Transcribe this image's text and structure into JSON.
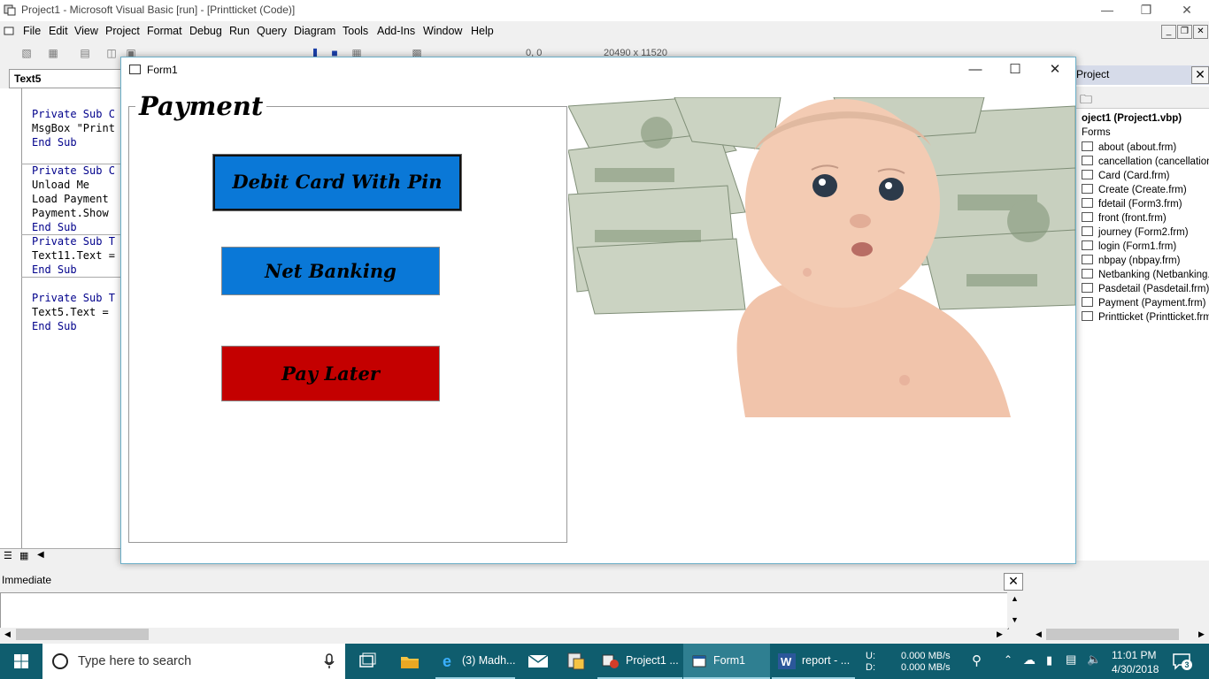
{
  "ide": {
    "title": "Project1 - Microsoft Visual Basic [run] - [Printticket (Code)]",
    "minimize_icon": "minimize-icon",
    "maximize_icon": "restore-icon",
    "close_icon": "close-icon"
  },
  "menu": [
    "File",
    "Edit",
    "View",
    "Project",
    "Format",
    "Debug",
    "Run",
    "Query",
    "Diagram",
    "Tools",
    "Add-Ins",
    "Window",
    "Help"
  ],
  "toolbar": {
    "position": "0, 0",
    "size": "20490 x 11520"
  },
  "code_window": {
    "object_combo": "Text5",
    "lines": [
      {
        "text": "Private Sub C",
        "kw": true
      },
      {
        "text": "MsgBox \"Print",
        "kw": false
      },
      {
        "text": "End Sub",
        "kw": true
      },
      {
        "text": "",
        "kw": false
      },
      {
        "text": "Private Sub C",
        "kw": true
      },
      {
        "text": "Unload Me",
        "kw": false
      },
      {
        "text": "Load Payment",
        "kw": false
      },
      {
        "text": "Payment.Show",
        "kw": false
      },
      {
        "text": "End Sub",
        "kw": true
      },
      {
        "text": "Private Sub T",
        "kw": true
      },
      {
        "text": "Text11.Text =",
        "kw": false
      },
      {
        "text": "End Sub",
        "kw": true
      },
      {
        "text": "",
        "kw": false
      },
      {
        "text": "Private Sub T",
        "kw": true
      },
      {
        "text": "Text5.Text =",
        "kw": false
      },
      {
        "text": "End Sub",
        "kw": true
      }
    ]
  },
  "form1": {
    "title": "Form1",
    "frame_caption": "Payment",
    "btn_debit": "Debit Card With Pin",
    "btn_net": "Net Banking",
    "btn_later": "Pay Later",
    "colors": {
      "debit": "#0a78d7",
      "net": "#0a78d7",
      "later": "#c40000"
    }
  },
  "project_explorer": {
    "title": "Project",
    "root": "oject1 (Project1.vbp)",
    "folder": "Forms",
    "items": [
      "about (about.frm)",
      "cancellation (cancellation.",
      "Card (Card.frm)",
      "Create (Create.frm)",
      "fdetail (Form3.frm)",
      "front (front.frm)",
      "journey (Form2.frm)",
      "login (Form1.frm)",
      "nbpay (nbpay.frm)",
      "Netbanking (Netbanking.f",
      "Pasdetail (Pasdetail.frm)",
      "Payment (Payment.frm)",
      "Printticket (Printticket.frm"
    ]
  },
  "immediate": {
    "title": "Immediate"
  },
  "taskbar": {
    "search_placeholder": "Type here to search",
    "apps": [
      {
        "label": "(3) Madh...",
        "icon": "edge-icon"
      },
      {
        "label": "Project1 ...",
        "icon": "vb6-icon"
      },
      {
        "label": "Form1",
        "icon": "form-icon"
      },
      {
        "label": "report - ...",
        "icon": "word-icon"
      }
    ],
    "net_u_label": "U:",
    "net_d_label": "D:",
    "net_u": "0.000 MB/s",
    "net_d": "0.000 MB/s",
    "time": "11:01 PM",
    "date": "4/30/2018",
    "notifications": "3"
  }
}
